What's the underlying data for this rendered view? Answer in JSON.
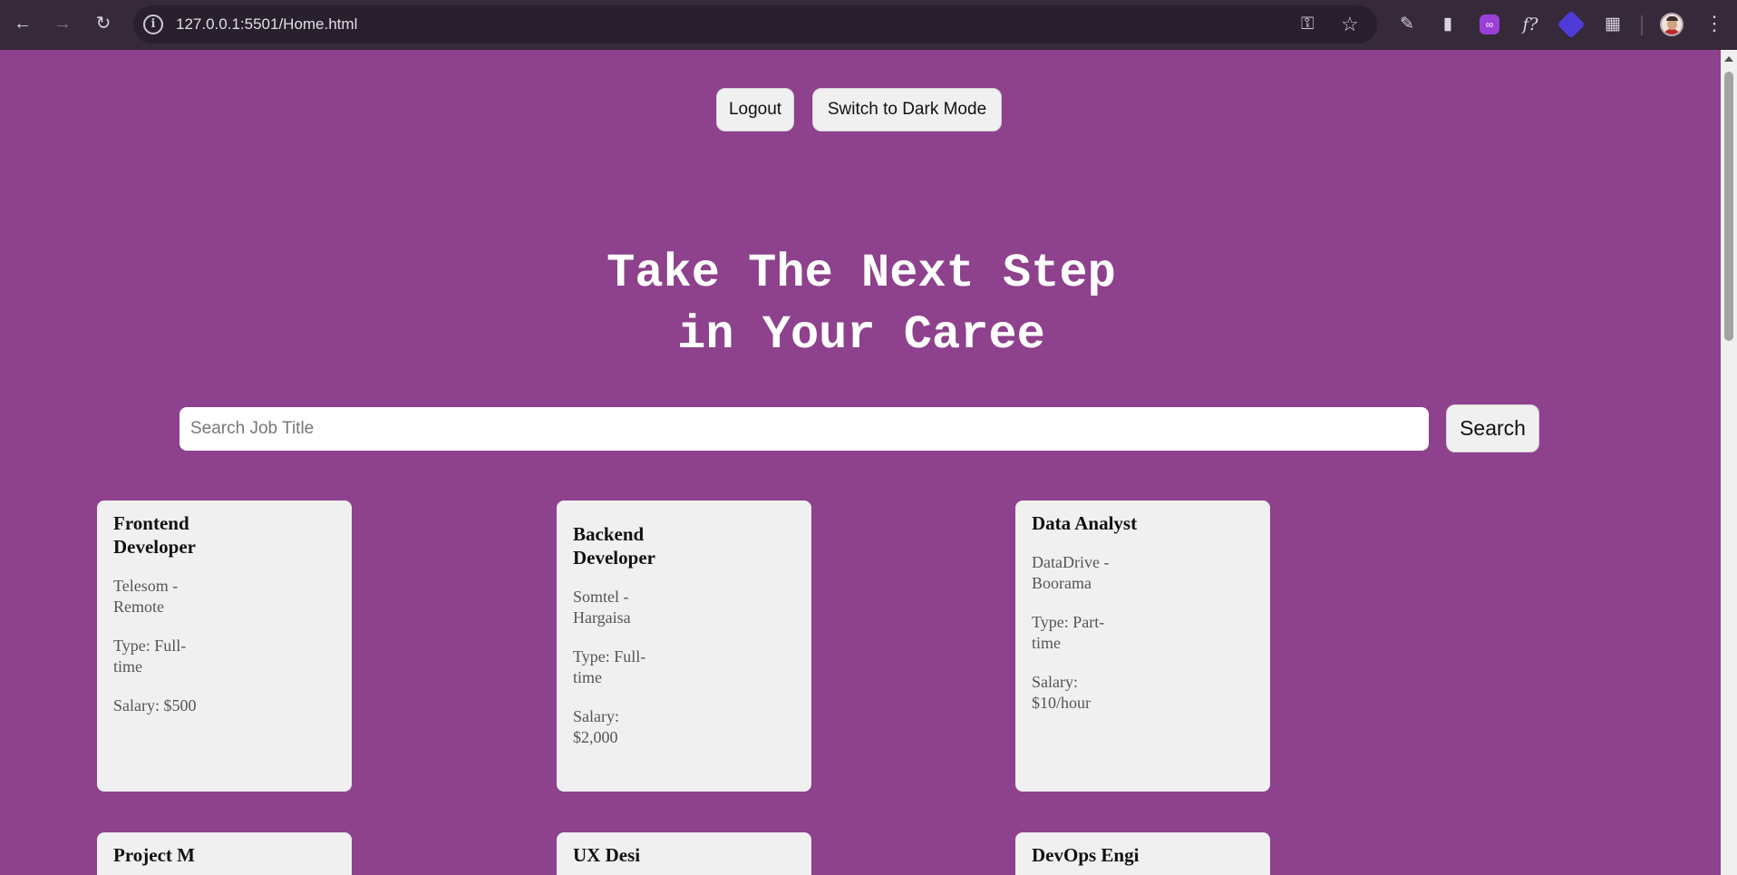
{
  "browser": {
    "url": "127.0.0.1:5501/Home.html"
  },
  "header": {
    "logout_label": "Logout",
    "dark_mode_label": "Switch to Dark Mode"
  },
  "hero": {
    "title_line1": "Take The Next Step",
    "title_line2": "in Your Caree"
  },
  "search": {
    "placeholder": "Search Job Title",
    "button_label": "Search"
  },
  "jobs": [
    {
      "title": "Frontend Developer",
      "company_location": "Telesom - Remote",
      "type": "Type: Full-time",
      "salary": "Salary: $500"
    },
    {
      "title": "Backend Developer",
      "company_location": "Somtel - Hargaisa",
      "type": "Type: Full-time",
      "salary": "Salary: $2,000"
    },
    {
      "title": "Data Analyst",
      "company_location": "DataDrive - Boorama",
      "type": "Type: Part-time",
      "salary": "Salary: $10/hour"
    },
    {
      "title": "Project M",
      "company_location": "",
      "type": "",
      "salary": ""
    },
    {
      "title": "UX Desi",
      "company_location": "",
      "type": "",
      "salary": ""
    },
    {
      "title": "DevOps Engi",
      "company_location": "",
      "type": "",
      "salary": ""
    }
  ],
  "colors": {
    "page_background": "#8e418c",
    "card_background": "#f0f0f0",
    "browser_frame": "#35293a"
  },
  "icons": {
    "back": "arrow-left-icon",
    "forward": "arrow-right-icon",
    "reload": "reload-icon",
    "site_info": "info-icon",
    "password": "key-icon",
    "bookmark": "star-icon",
    "menu": "kebab-menu-icon"
  }
}
